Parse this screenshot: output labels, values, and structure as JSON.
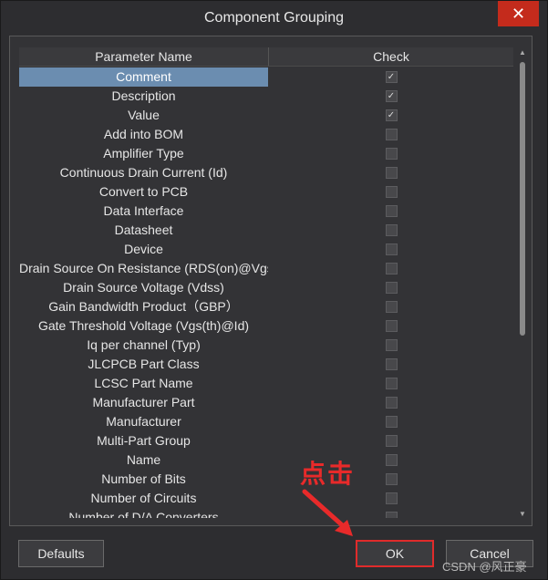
{
  "dialog": {
    "title": "Component Grouping",
    "close_symbol": "✕"
  },
  "table": {
    "headers": {
      "name": "Parameter Name",
      "check": "Check"
    },
    "rows": [
      {
        "name": "Comment",
        "checked": true,
        "selected": true
      },
      {
        "name": "Description",
        "checked": true
      },
      {
        "name": "Value",
        "checked": true
      },
      {
        "name": "Add into BOM",
        "checked": false
      },
      {
        "name": "Amplifier Type",
        "checked": false
      },
      {
        "name": "Continuous Drain Current (Id)",
        "checked": false
      },
      {
        "name": "Convert to PCB",
        "checked": false
      },
      {
        "name": "Data Interface",
        "checked": false
      },
      {
        "name": "Datasheet",
        "checked": false
      },
      {
        "name": "Device",
        "checked": false
      },
      {
        "name": "Drain Source On Resistance (RDS(on)@Vgs,",
        "checked": false
      },
      {
        "name": "Drain Source Voltage (Vdss)",
        "checked": false
      },
      {
        "name": "Gain Bandwidth Product（GBP）",
        "checked": false
      },
      {
        "name": "Gate Threshold Voltage (Vgs(th)@Id)",
        "checked": false
      },
      {
        "name": "Iq per channel (Typ)",
        "checked": false
      },
      {
        "name": "JLCPCB Part Class",
        "checked": false
      },
      {
        "name": "LCSC Part Name",
        "checked": false
      },
      {
        "name": "Manufacturer Part",
        "checked": false
      },
      {
        "name": "Manufacturer",
        "checked": false
      },
      {
        "name": "Multi-Part Group",
        "checked": false
      },
      {
        "name": "Name",
        "checked": false
      },
      {
        "name": "Number of Bits",
        "checked": false
      },
      {
        "name": "Number of Circuits",
        "checked": false
      },
      {
        "name": "Number of D/A Converters",
        "checked": false
      }
    ]
  },
  "buttons": {
    "defaults": "Defaults",
    "ok": "OK",
    "cancel": "Cancel"
  },
  "annotation": {
    "text": "点击",
    "color": "#e82a2a"
  },
  "watermark": "CSDN @风正豪"
}
